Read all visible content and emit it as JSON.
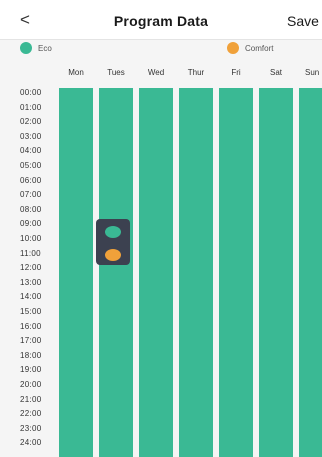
{
  "header": {
    "back_label": "<",
    "title": "Program Data",
    "save_label": "Save"
  },
  "legend": [
    {
      "label": "Eco",
      "color": "#3ab994"
    },
    {
      "label": "Comfort",
      "color": "#f0a13a"
    }
  ],
  "days": [
    "Mon",
    "Tues",
    "Wed",
    "Thur",
    "Fri",
    "Sat",
    "Sun"
  ],
  "hours": [
    "00:00",
    "01:00",
    "02:00",
    "03:00",
    "04:00",
    "05:00",
    "06:00",
    "07:00",
    "08:00",
    "09:00",
    "10:00",
    "11:00",
    "12:00",
    "13:00",
    "14:00",
    "15:00",
    "16:00",
    "17:00",
    "18:00",
    "19:00",
    "20:00",
    "21:00",
    "22:00",
    "23:00",
    "24:00"
  ],
  "schedule_mode": "Eco",
  "colors": {
    "eco": "#3ab994",
    "comfort": "#f0a13a",
    "panel": "#3c4150"
  },
  "mode_picker": {
    "options": [
      "Eco",
      "Comfort"
    ],
    "day": "Tues"
  }
}
